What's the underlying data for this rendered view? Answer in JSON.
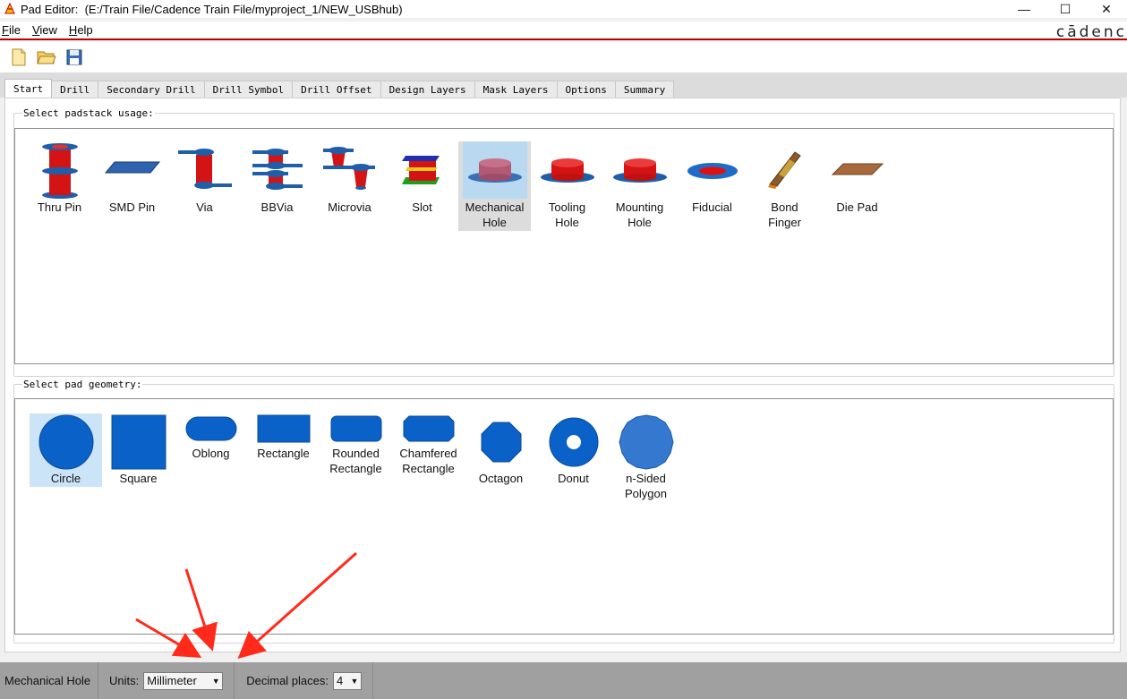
{
  "window": {
    "title_prefix": "Pad Editor:",
    "file_path": "(E:/Train File/Cadence Train File/myproject_1/NEW_USBhub)",
    "minimize": "—",
    "maximize": "☐",
    "close": "✕",
    "brand": "cādenc"
  },
  "menu": [
    {
      "label": "File",
      "key": "F",
      "rest": "ile"
    },
    {
      "label": "View",
      "key": "V",
      "rest": "iew"
    },
    {
      "label": "Help",
      "key": "H",
      "rest": "elp"
    }
  ],
  "tabs": [
    "Start",
    "Drill",
    "Secondary Drill",
    "Drill Symbol",
    "Drill Offset",
    "Design Layers",
    "Mask Layers",
    "Options",
    "Summary"
  ],
  "usage": {
    "label": "Select padstack usage:",
    "items": [
      {
        "line1": "Thru Pin",
        "line2": ""
      },
      {
        "line1": "SMD Pin",
        "line2": ""
      },
      {
        "line1": "Via",
        "line2": ""
      },
      {
        "line1": "BBVia",
        "line2": ""
      },
      {
        "line1": "Microvia",
        "line2": ""
      },
      {
        "line1": "Slot",
        "line2": ""
      },
      {
        "line1": "Mechanical",
        "line2": "Hole"
      },
      {
        "line1": "Tooling",
        "line2": "Hole"
      },
      {
        "line1": "Mounting",
        "line2": "Hole"
      },
      {
        "line1": "Fiducial",
        "line2": ""
      },
      {
        "line1": "Bond",
        "line2": "Finger"
      },
      {
        "line1": "Die Pad",
        "line2": ""
      }
    ],
    "selected": "Mechanical Hole"
  },
  "geometry": {
    "label": "Select pad geometry:",
    "items": [
      {
        "line1": "Circle",
        "line2": ""
      },
      {
        "line1": "Square",
        "line2": ""
      },
      {
        "line1": "Oblong",
        "line2": ""
      },
      {
        "line1": "Rectangle",
        "line2": ""
      },
      {
        "line1": "Rounded",
        "line2": "Rectangle"
      },
      {
        "line1": "Chamfered",
        "line2": "Rectangle"
      },
      {
        "line1": "Octagon",
        "line2": ""
      },
      {
        "line1": "Donut",
        "line2": ""
      },
      {
        "line1": "n-Sided",
        "line2": "Polygon"
      }
    ],
    "selected": "Circle"
  },
  "status": {
    "usage_text": "Mechanical Hole",
    "units_label": "Units:",
    "units_value": "Millimeter",
    "decimal_label": "Decimal places:",
    "decimal_value": "4"
  },
  "colors": {
    "pad_blue": "#0a5fc8",
    "barrel_red": "#e01010",
    "accent_red": "#c00000",
    "annotation_arrow": "#ff2a1a"
  }
}
